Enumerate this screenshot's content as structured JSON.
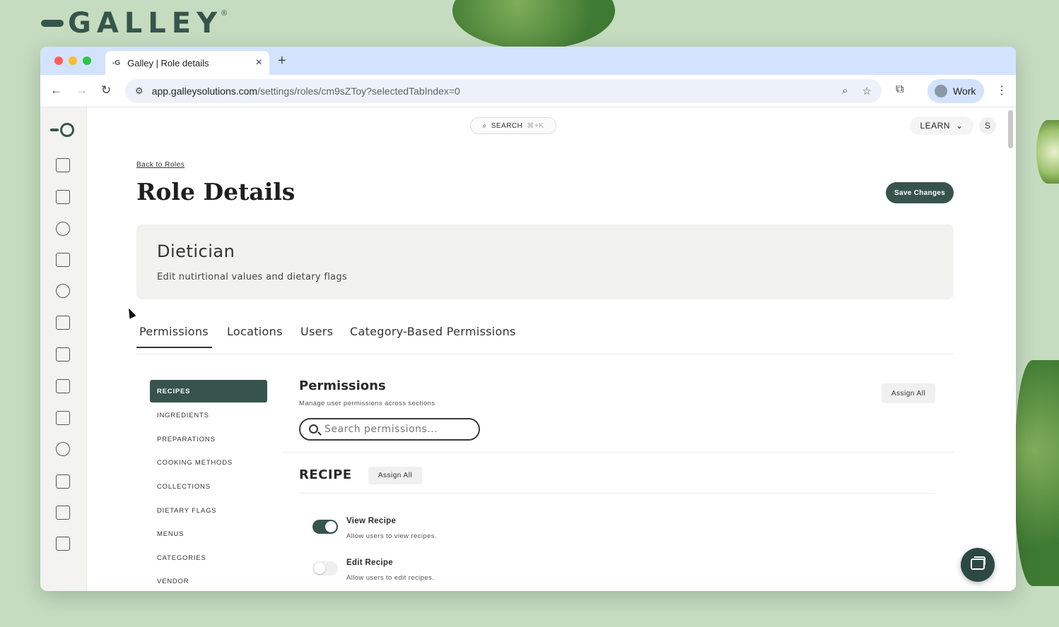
{
  "brand": {
    "wordmark": "GALLEY",
    "reg": "®"
  },
  "browser": {
    "tab_title": "Galley | Role details",
    "tab_favicon": "-G",
    "tab_close": "×",
    "new_tab": "+",
    "url_host": "app.galleysolutions.com",
    "url_path": "/settings/roles/cm9sZToy?selectedTabIndex=0",
    "profile_name": "Work",
    "back": "←",
    "forward": "→",
    "reload": "↻",
    "zoom_icon": "⌕",
    "star_icon": "☆",
    "ext_icon": "⧉",
    "kebab": "⋮"
  },
  "topbar": {
    "search_label": "SEARCH",
    "search_shortcut": "⌘+K",
    "learn_label": "LEARN",
    "learn_caret": "⌄",
    "user_initial": "S"
  },
  "page": {
    "back_link": "Back to Roles",
    "title": "Role Details",
    "save_label": "Save Changes"
  },
  "role": {
    "name": "Dietician",
    "description": "Edit nutirtional values and dietary flags"
  },
  "tabs": [
    {
      "label": "Permissions"
    },
    {
      "label": "Locations"
    },
    {
      "label": "Users"
    },
    {
      "label": "Category-Based Permissions"
    }
  ],
  "categories": [
    {
      "label": "RECIPES"
    },
    {
      "label": "INGREDIENTS"
    },
    {
      "label": "PREPARATIONS"
    },
    {
      "label": "COOKING METHODS"
    },
    {
      "label": "COLLECTIONS"
    },
    {
      "label": "DIETARY FLAGS"
    },
    {
      "label": "MENUS"
    },
    {
      "label": "CATEGORIES"
    },
    {
      "label": "VENDOR"
    }
  ],
  "permissions": {
    "title": "Permissions",
    "subtitle": "Manage user permissions across sections",
    "assign_all_label": "Assign All",
    "search_placeholder": "Search permissions...",
    "section_title": "RECIPE",
    "section_assign_label": "Assign All",
    "items": [
      {
        "name": "View Recipe",
        "description": "Allow users to view recipes.",
        "enabled": true
      },
      {
        "name": "Edit Recipe",
        "description": "Allow users to edit recipes.",
        "enabled": false
      }
    ]
  },
  "colors": {
    "brand_dark": "#37544c",
    "background_green": "#c5dcc0"
  }
}
